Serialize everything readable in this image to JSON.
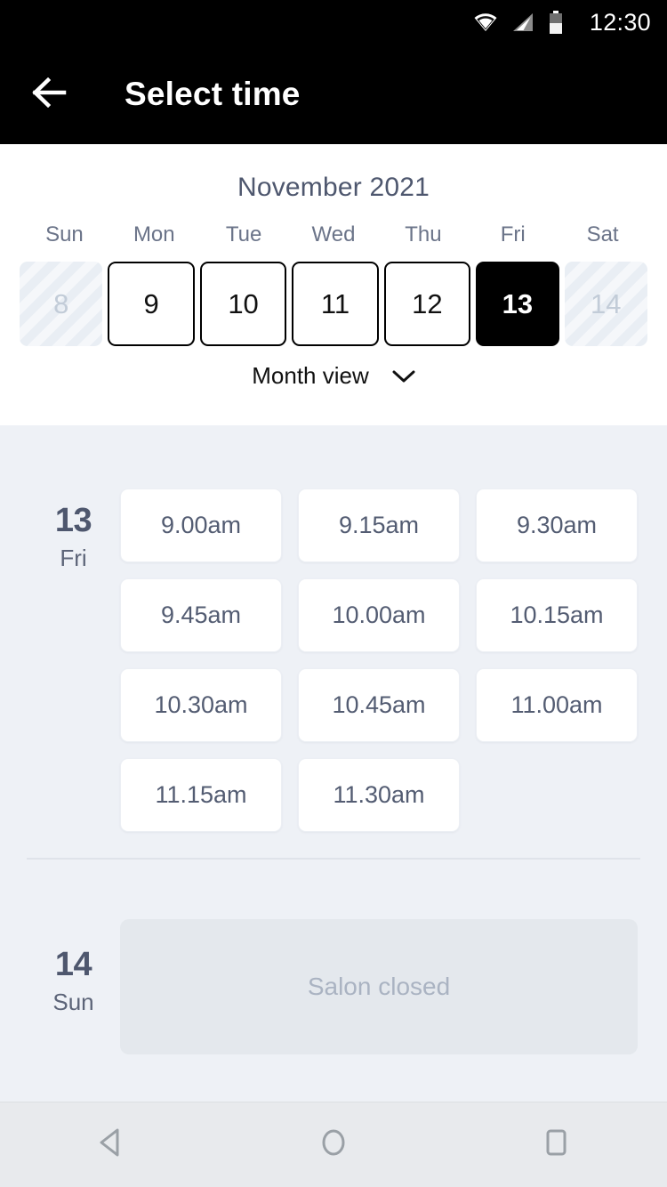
{
  "status_bar": {
    "time": "12:30",
    "icons": [
      "wifi-icon",
      "cellular-signal-icon",
      "battery-icon"
    ]
  },
  "app_bar": {
    "back_icon": "arrow-left-icon",
    "title": "Select time"
  },
  "calendar": {
    "month_label": "November 2021",
    "weekdays": [
      "Sun",
      "Mon",
      "Tue",
      "Wed",
      "Thu",
      "Fri",
      "Sat"
    ],
    "days": [
      {
        "number": "8",
        "state": "disabled"
      },
      {
        "number": "9",
        "state": "available"
      },
      {
        "number": "10",
        "state": "available"
      },
      {
        "number": "11",
        "state": "available"
      },
      {
        "number": "12",
        "state": "available"
      },
      {
        "number": "13",
        "state": "selected"
      },
      {
        "number": "14",
        "state": "disabled"
      }
    ],
    "view_toggle_label": "Month view",
    "view_toggle_icon": "chevron-down-icon"
  },
  "schedule": [
    {
      "day_number": "13",
      "day_name": "Fri",
      "slots": [
        "9.00am",
        "9.15am",
        "9.30am",
        "9.45am",
        "10.00am",
        "10.15am",
        "10.30am",
        "10.45am",
        "11.00am",
        "11.15am",
        "11.30am"
      ]
    },
    {
      "day_number": "14",
      "day_name": "Sun",
      "closed_message": "Salon closed"
    }
  ],
  "nav_bar": {
    "back": "nav-back-icon",
    "home": "nav-home-icon",
    "recents": "nav-recents-icon"
  },
  "colors": {
    "app_bar_bg": "#000000",
    "panel_bg": "#ffffff",
    "page_bg": "#eef1f6",
    "selected_day_bg": "#000000",
    "text_slate": "#4e576e",
    "slot_text": "#535c72",
    "closed_card_bg": "#e4e8ed",
    "closed_text": "#aab3c2"
  }
}
